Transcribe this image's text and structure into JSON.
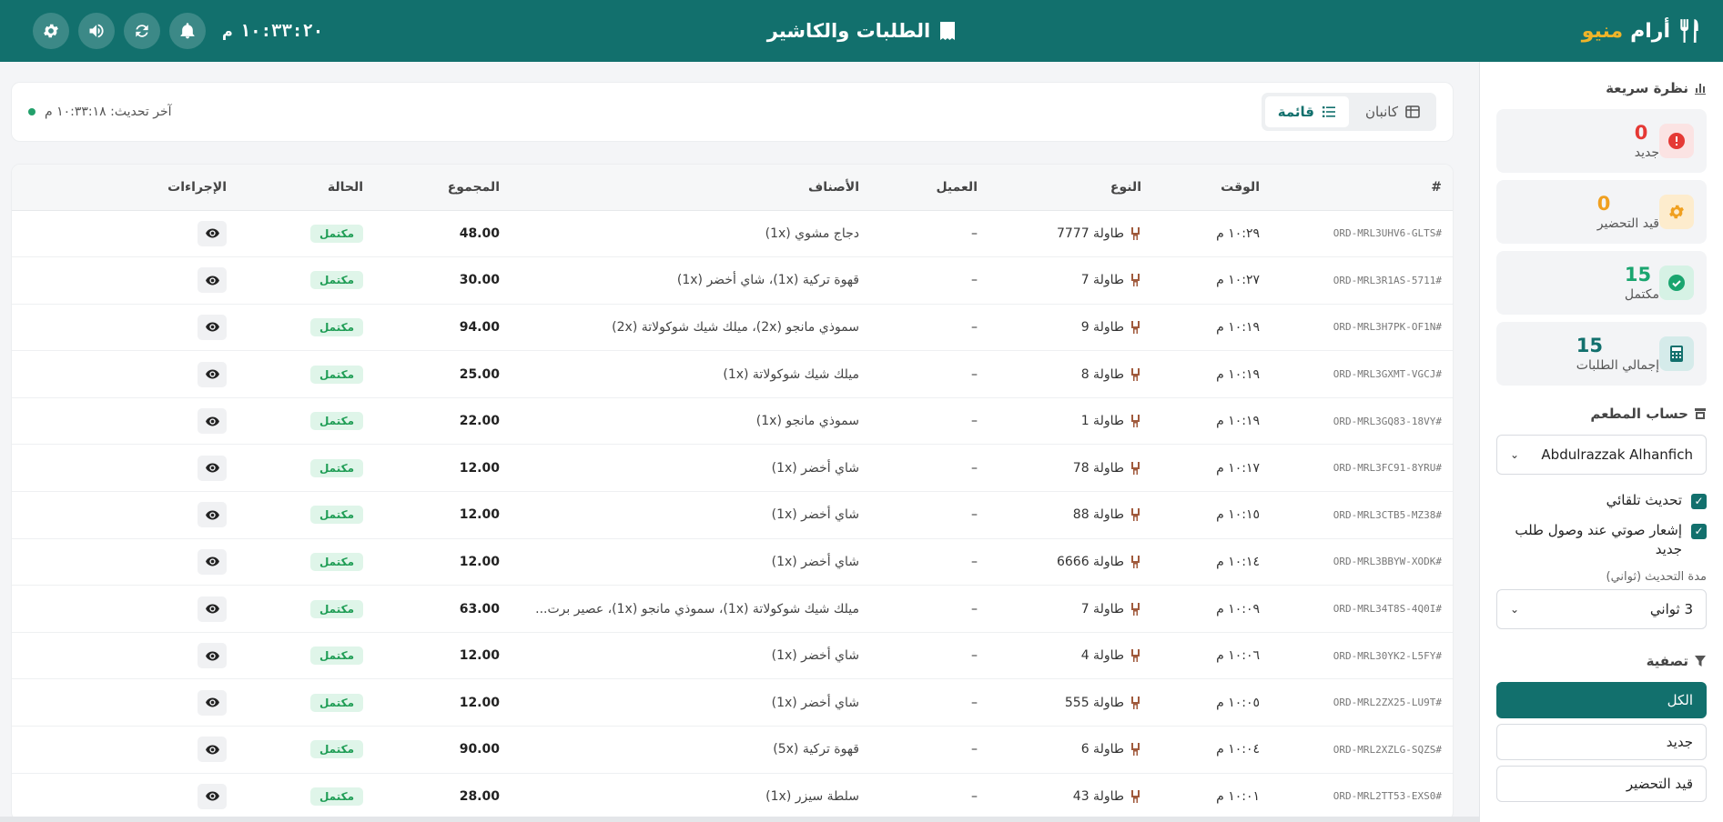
{
  "header": {
    "brand_part1": "أرام",
    "brand_part2": "منيو",
    "title": "الطلبات والكاشير",
    "clock": "١٠:٣٣:٢٠",
    "clock_ampm": "م",
    "icons": [
      "gear-icon",
      "volume-icon",
      "refresh-icon",
      "bell-icon"
    ]
  },
  "sidebar": {
    "overview_title": "نظرة سريعة",
    "stats": [
      {
        "value": "0",
        "label": "جديد",
        "color": "#e53935",
        "icon": "alert-icon"
      },
      {
        "value": "0",
        "label": "قيد التحضير",
        "color": "#f0a020",
        "icon": "gear-icon"
      },
      {
        "value": "15",
        "label": "مكتمل",
        "color": "#1aa56f",
        "icon": "check-icon"
      },
      {
        "value": "15",
        "label": "إجمالي الطلبات",
        "color": "#12706d",
        "icon": "calculator-icon"
      }
    ],
    "account_title": "حساب المطعم",
    "account_value": "Abdulrazzak Alhanfich",
    "auto_refresh": "تحديث تلقائي",
    "sound_alert": "إشعار صوتي عند وصول طلب جديد",
    "interval_label": "مدة التحديث (ثواني)",
    "interval_value": "3 ثواني",
    "filter_title": "تصفية",
    "filters": [
      "الكل",
      "جديد",
      "قيد التحضير"
    ]
  },
  "toolbar": {
    "kanban_label": "كانبان",
    "list_label": "قائمة",
    "last_update": "آخر تحديث: ١٠:٣٣:١٨ م"
  },
  "table": {
    "headers": {
      "id": "#",
      "time": "الوقت",
      "type": "النوع",
      "customer": "العميل",
      "items": "الأصناف",
      "total": "المجموع",
      "status": "الحالة",
      "actions": "الإجراءات"
    },
    "rows": [
      {
        "id": "ORD-MRL3UHV6-GLTS#",
        "time": "١٠:٢٩ م",
        "type": "طاولة 7777",
        "customer": "–",
        "items": "دجاج مشوي (1x)",
        "total": "48.00",
        "status": "مكتمل"
      },
      {
        "id": "ORD-MRL3R1AS-5711#",
        "time": "١٠:٢٧ م",
        "type": "طاولة 7",
        "customer": "–",
        "items": "قهوة تركية (1x)، شاي أخضر (1x)",
        "total": "30.00",
        "status": "مكتمل"
      },
      {
        "id": "ORD-MRL3H7PK-OF1N#",
        "time": "١٠:١٩ م",
        "type": "طاولة 9",
        "customer": "–",
        "items": "سموذي مانجو (2x)، ميلك شيك شوكولاتة (2x)",
        "total": "94.00",
        "status": "مكتمل"
      },
      {
        "id": "ORD-MRL3GXMT-VGCJ#",
        "time": "١٠:١٩ م",
        "type": "طاولة 8",
        "customer": "–",
        "items": "ميلك شيك شوكولاتة (1x)",
        "total": "25.00",
        "status": "مكتمل"
      },
      {
        "id": "ORD-MRL3GQ83-18VY#",
        "time": "١٠:١٩ م",
        "type": "طاولة 1",
        "customer": "–",
        "items": "سموذي مانجو (1x)",
        "total": "22.00",
        "status": "مكتمل"
      },
      {
        "id": "ORD-MRL3FC91-8YRU#",
        "time": "١٠:١٧ م",
        "type": "طاولة 78",
        "customer": "–",
        "items": "شاي أخضر (1x)",
        "total": "12.00",
        "status": "مكتمل"
      },
      {
        "id": "ORD-MRL3CTB5-MZ38#",
        "time": "١٠:١٥ م",
        "type": "طاولة 88",
        "customer": "–",
        "items": "شاي أخضر (1x)",
        "total": "12.00",
        "status": "مكتمل"
      },
      {
        "id": "ORD-MRL3BBYW-XODK#",
        "time": "١٠:١٤ م",
        "type": "طاولة 6666",
        "customer": "–",
        "items": "شاي أخضر (1x)",
        "total": "12.00",
        "status": "مكتمل"
      },
      {
        "id": "ORD-MRL34T8S-4Q0I#",
        "time": "١٠:٠٩ م",
        "type": "طاولة 7",
        "customer": "–",
        "items": "ميلك شيك شوكولاتة (1x)، سموذي مانجو (1x)، عصير برت...",
        "total": "63.00",
        "status": "مكتمل"
      },
      {
        "id": "ORD-MRL30YK2-L5FY#",
        "time": "١٠:٠٦ م",
        "type": "طاولة 4",
        "customer": "–",
        "items": "شاي أخضر (1x)",
        "total": "12.00",
        "status": "مكتمل"
      },
      {
        "id": "ORD-MRL2ZX25-LU9T#",
        "time": "١٠:٠٥ م",
        "type": "طاولة 555",
        "customer": "–",
        "items": "شاي أخضر (1x)",
        "total": "12.00",
        "status": "مكتمل"
      },
      {
        "id": "ORD-MRL2XZLG-SQZS#",
        "time": "١٠:٠٤ م",
        "type": "طاولة 6",
        "customer": "–",
        "items": "قهوة تركية (5x)",
        "total": "90.00",
        "status": "مكتمل"
      },
      {
        "id": "ORD-MRL2TT53-EXS0#",
        "time": "١٠:٠١ م",
        "type": "طاولة 43",
        "customer": "–",
        "items": "سلطة سيزر (1x)",
        "total": "28.00",
        "status": "مكتمل"
      }
    ]
  }
}
